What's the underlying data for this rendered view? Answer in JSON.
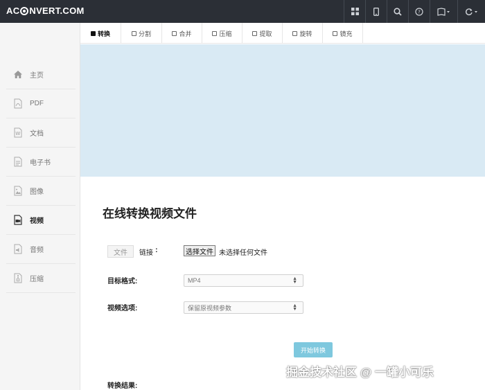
{
  "app": {
    "logo_text_left": "AC",
    "logo_text_right": "NVERT.COM",
    "colors": {
      "topbar": "#2b2f36",
      "banner": "#d9eaf4",
      "accent": "#7ec8de"
    }
  },
  "topbar": {
    "icons": [
      "grid-icon",
      "mobile-icon",
      "search-icon",
      "help-icon",
      "language-icon",
      "refresh-icon"
    ]
  },
  "sidebar": {
    "items": [
      {
        "label": "主页",
        "icon": "home-icon",
        "active": false
      },
      {
        "label": "PDF",
        "icon": "pdf-icon",
        "active": false
      },
      {
        "label": "文档",
        "icon": "word-icon",
        "active": false
      },
      {
        "label": "电子书",
        "icon": "ebook-icon",
        "active": false
      },
      {
        "label": "图像",
        "icon": "image-icon",
        "active": false
      },
      {
        "label": "视频",
        "icon": "video-icon",
        "active": true
      },
      {
        "label": "音频",
        "icon": "audio-icon",
        "active": false
      },
      {
        "label": "压缩",
        "icon": "archive-icon",
        "active": false
      }
    ]
  },
  "tabs": [
    {
      "label": "转换",
      "active": true
    },
    {
      "label": "分割",
      "active": false
    },
    {
      "label": "合并",
      "active": false
    },
    {
      "label": "压缩",
      "active": false
    },
    {
      "label": "提取",
      "active": false
    },
    {
      "label": "旋转",
      "active": false
    },
    {
      "label": "镜充",
      "active": false
    }
  ],
  "main": {
    "title": "在线转换视频文件",
    "source_file": "文件",
    "source_link": "链接",
    "colon": ":",
    "choose_file": "选择文件",
    "no_file": "未选择任何文件",
    "target_label": "目标格式:",
    "target_value": "MP4",
    "options_label": "视频选项:",
    "options_value": "保留原视频参数",
    "submit": "开始转换",
    "result_label": "转换结果:"
  },
  "watermark": "掘金技术社区 @ 一罐小可乐"
}
